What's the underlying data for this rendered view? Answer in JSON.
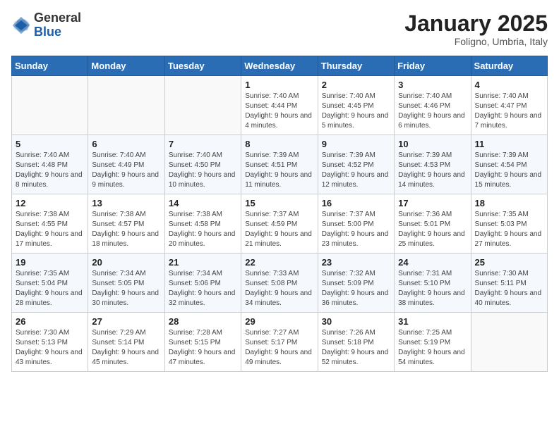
{
  "header": {
    "logo_general": "General",
    "logo_blue": "Blue",
    "month_title": "January 2025",
    "subtitle": "Foligno, Umbria, Italy"
  },
  "weekdays": [
    "Sunday",
    "Monday",
    "Tuesday",
    "Wednesday",
    "Thursday",
    "Friday",
    "Saturday"
  ],
  "weeks": [
    [
      {
        "day": "",
        "info": ""
      },
      {
        "day": "",
        "info": ""
      },
      {
        "day": "",
        "info": ""
      },
      {
        "day": "1",
        "info": "Sunrise: 7:40 AM\nSunset: 4:44 PM\nDaylight: 9 hours and 4 minutes."
      },
      {
        "day": "2",
        "info": "Sunrise: 7:40 AM\nSunset: 4:45 PM\nDaylight: 9 hours and 5 minutes."
      },
      {
        "day": "3",
        "info": "Sunrise: 7:40 AM\nSunset: 4:46 PM\nDaylight: 9 hours and 6 minutes."
      },
      {
        "day": "4",
        "info": "Sunrise: 7:40 AM\nSunset: 4:47 PM\nDaylight: 9 hours and 7 minutes."
      }
    ],
    [
      {
        "day": "5",
        "info": "Sunrise: 7:40 AM\nSunset: 4:48 PM\nDaylight: 9 hours and 8 minutes."
      },
      {
        "day": "6",
        "info": "Sunrise: 7:40 AM\nSunset: 4:49 PM\nDaylight: 9 hours and 9 minutes."
      },
      {
        "day": "7",
        "info": "Sunrise: 7:40 AM\nSunset: 4:50 PM\nDaylight: 9 hours and 10 minutes."
      },
      {
        "day": "8",
        "info": "Sunrise: 7:39 AM\nSunset: 4:51 PM\nDaylight: 9 hours and 11 minutes."
      },
      {
        "day": "9",
        "info": "Sunrise: 7:39 AM\nSunset: 4:52 PM\nDaylight: 9 hours and 12 minutes."
      },
      {
        "day": "10",
        "info": "Sunrise: 7:39 AM\nSunset: 4:53 PM\nDaylight: 9 hours and 14 minutes."
      },
      {
        "day": "11",
        "info": "Sunrise: 7:39 AM\nSunset: 4:54 PM\nDaylight: 9 hours and 15 minutes."
      }
    ],
    [
      {
        "day": "12",
        "info": "Sunrise: 7:38 AM\nSunset: 4:55 PM\nDaylight: 9 hours and 17 minutes."
      },
      {
        "day": "13",
        "info": "Sunrise: 7:38 AM\nSunset: 4:57 PM\nDaylight: 9 hours and 18 minutes."
      },
      {
        "day": "14",
        "info": "Sunrise: 7:38 AM\nSunset: 4:58 PM\nDaylight: 9 hours and 20 minutes."
      },
      {
        "day": "15",
        "info": "Sunrise: 7:37 AM\nSunset: 4:59 PM\nDaylight: 9 hours and 21 minutes."
      },
      {
        "day": "16",
        "info": "Sunrise: 7:37 AM\nSunset: 5:00 PM\nDaylight: 9 hours and 23 minutes."
      },
      {
        "day": "17",
        "info": "Sunrise: 7:36 AM\nSunset: 5:01 PM\nDaylight: 9 hours and 25 minutes."
      },
      {
        "day": "18",
        "info": "Sunrise: 7:35 AM\nSunset: 5:03 PM\nDaylight: 9 hours and 27 minutes."
      }
    ],
    [
      {
        "day": "19",
        "info": "Sunrise: 7:35 AM\nSunset: 5:04 PM\nDaylight: 9 hours and 28 minutes."
      },
      {
        "day": "20",
        "info": "Sunrise: 7:34 AM\nSunset: 5:05 PM\nDaylight: 9 hours and 30 minutes."
      },
      {
        "day": "21",
        "info": "Sunrise: 7:34 AM\nSunset: 5:06 PM\nDaylight: 9 hours and 32 minutes."
      },
      {
        "day": "22",
        "info": "Sunrise: 7:33 AM\nSunset: 5:08 PM\nDaylight: 9 hours and 34 minutes."
      },
      {
        "day": "23",
        "info": "Sunrise: 7:32 AM\nSunset: 5:09 PM\nDaylight: 9 hours and 36 minutes."
      },
      {
        "day": "24",
        "info": "Sunrise: 7:31 AM\nSunset: 5:10 PM\nDaylight: 9 hours and 38 minutes."
      },
      {
        "day": "25",
        "info": "Sunrise: 7:30 AM\nSunset: 5:11 PM\nDaylight: 9 hours and 40 minutes."
      }
    ],
    [
      {
        "day": "26",
        "info": "Sunrise: 7:30 AM\nSunset: 5:13 PM\nDaylight: 9 hours and 43 minutes."
      },
      {
        "day": "27",
        "info": "Sunrise: 7:29 AM\nSunset: 5:14 PM\nDaylight: 9 hours and 45 minutes."
      },
      {
        "day": "28",
        "info": "Sunrise: 7:28 AM\nSunset: 5:15 PM\nDaylight: 9 hours and 47 minutes."
      },
      {
        "day": "29",
        "info": "Sunrise: 7:27 AM\nSunset: 5:17 PM\nDaylight: 9 hours and 49 minutes."
      },
      {
        "day": "30",
        "info": "Sunrise: 7:26 AM\nSunset: 5:18 PM\nDaylight: 9 hours and 52 minutes."
      },
      {
        "day": "31",
        "info": "Sunrise: 7:25 AM\nSunset: 5:19 PM\nDaylight: 9 hours and 54 minutes."
      },
      {
        "day": "",
        "info": ""
      }
    ]
  ]
}
